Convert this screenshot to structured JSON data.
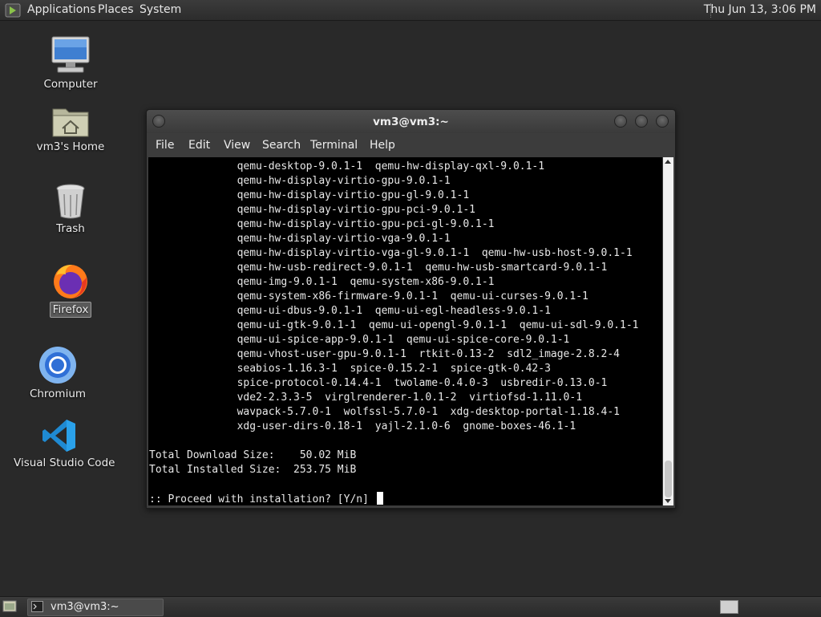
{
  "top_panel": {
    "menus": [
      "Applications",
      "Places",
      "System"
    ],
    "clock": "Thu Jun 13,  3:06 PM"
  },
  "desktop_icons": {
    "computer": "Computer",
    "home": "vm3's Home",
    "trash": "Trash",
    "firefox": "Firefox",
    "chromium": "Chromium",
    "vscode": "Visual Studio Code"
  },
  "window": {
    "title": "vm3@vm3:~",
    "menus": [
      "File",
      "Edit",
      "View",
      "Search",
      "Terminal",
      "Help"
    ]
  },
  "terminal": {
    "lines": [
      "              qemu-desktop-9.0.1-1  qemu-hw-display-qxl-9.0.1-1",
      "              qemu-hw-display-virtio-gpu-9.0.1-1",
      "              qemu-hw-display-virtio-gpu-gl-9.0.1-1",
      "              qemu-hw-display-virtio-gpu-pci-9.0.1-1",
      "              qemu-hw-display-virtio-gpu-pci-gl-9.0.1-1",
      "              qemu-hw-display-virtio-vga-9.0.1-1",
      "              qemu-hw-display-virtio-vga-gl-9.0.1-1  qemu-hw-usb-host-9.0.1-1",
      "              qemu-hw-usb-redirect-9.0.1-1  qemu-hw-usb-smartcard-9.0.1-1",
      "              qemu-img-9.0.1-1  qemu-system-x86-9.0.1-1",
      "              qemu-system-x86-firmware-9.0.1-1  qemu-ui-curses-9.0.1-1",
      "              qemu-ui-dbus-9.0.1-1  qemu-ui-egl-headless-9.0.1-1",
      "              qemu-ui-gtk-9.0.1-1  qemu-ui-opengl-9.0.1-1  qemu-ui-sdl-9.0.1-1",
      "              qemu-ui-spice-app-9.0.1-1  qemu-ui-spice-core-9.0.1-1",
      "              qemu-vhost-user-gpu-9.0.1-1  rtkit-0.13-2  sdl2_image-2.8.2-4",
      "              seabios-1.16.3-1  spice-0.15.2-1  spice-gtk-0.42-3",
      "              spice-protocol-0.14.4-1  twolame-0.4.0-3  usbredir-0.13.0-1",
      "              vde2-2.3.3-5  virglrenderer-1.0.1-2  virtiofsd-1.11.0-1",
      "              wavpack-5.7.0-1  wolfssl-5.7.0-1  xdg-desktop-portal-1.18.4-1",
      "              xdg-user-dirs-0.18-1  yajl-2.1.0-6  gnome-boxes-46.1-1",
      "",
      "Total Download Size:    50.02 MiB",
      "Total Installed Size:  253.75 MiB",
      ""
    ],
    "prompt": ":: Proceed with installation? [Y/n] "
  },
  "taskbar": {
    "task_label": "vm3@vm3:~"
  }
}
